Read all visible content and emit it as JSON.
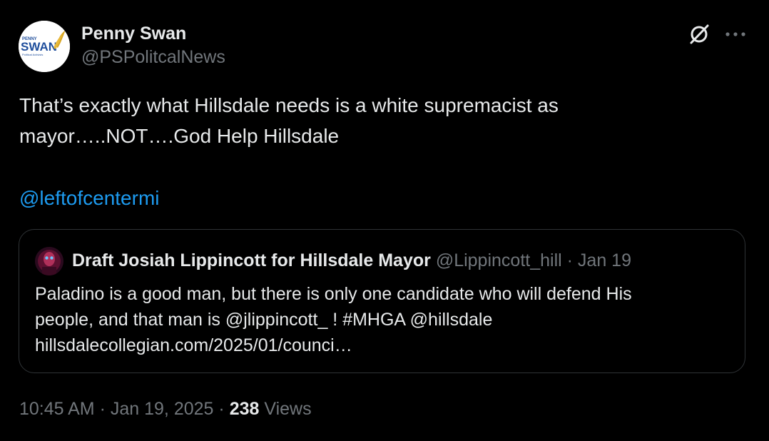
{
  "author": {
    "display_name": "Penny Swan",
    "handle": "@PSPolitcalNews",
    "avatar_text_top": "PENNY",
    "avatar_text_main": "SWAN",
    "avatar_text_sub": "Political Activists"
  },
  "tweet": {
    "text_line_1": "That’s exactly what Hillsdale needs is a white supremacist as",
    "text_line_2": "mayor…..NOT….God Help Hillsdale",
    "mention": "@leftofcentermi"
  },
  "quote": {
    "name": "Draft Josiah Lippincott for Hillsdale Mayor",
    "handle": "@Lippincott_hill",
    "separator": "·",
    "date": "Jan 19",
    "body_line_1": "Paladino is a good man, but there is only one candidate who will defend His",
    "body_line_2": "people, and that man is @jlippincott_ ! #MHGA @hillsdale",
    "body_line_3": "hillsdalecollegian.com/2025/01/counci…"
  },
  "meta": {
    "time": "10:45 AM",
    "separator_1": "·",
    "date": "Jan 19, 2025",
    "separator_2": "·",
    "views_count": "238",
    "views_label": "Views"
  },
  "icons": {
    "grok": "grok-icon",
    "more": "more-icon"
  },
  "colors": {
    "background": "#000000",
    "text": "#e7e9ea",
    "muted": "#71767b",
    "link": "#1d9bf0",
    "border": "#2f3336",
    "avatar_blue": "#1f4e9c",
    "avatar_gold": "#d8a623"
  }
}
